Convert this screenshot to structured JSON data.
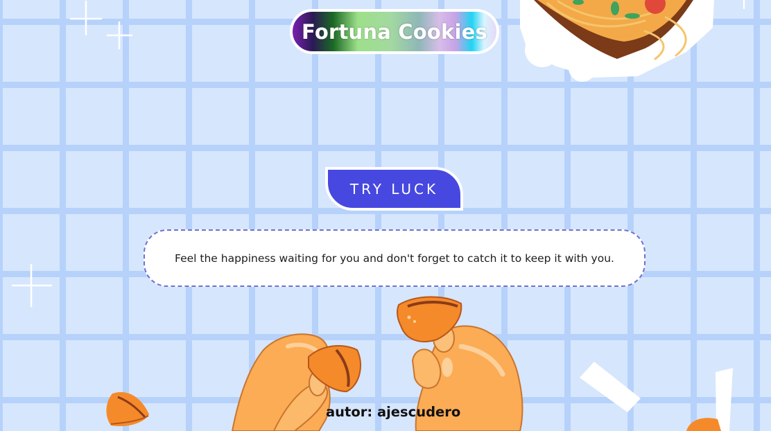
{
  "header": {
    "title": "Fortuna Cookies"
  },
  "main": {
    "try_button_label": "TRY LUCK",
    "fortune_message": "Feel the happiness waiting for you and don't forget to catch it to keep it with you."
  },
  "footer": {
    "author": "autor: ajescudero"
  },
  "decorations": [
    {
      "name": "noodle-box-illustration"
    },
    {
      "name": "sparkle-icon"
    },
    {
      "name": "hands-holding-cookies-illustration"
    },
    {
      "name": "fortune-cookie-icon"
    },
    {
      "name": "paper-strip-icon"
    }
  ],
  "colors": {
    "background": "#d6e6fd",
    "grid_lines": "#b6d2fb",
    "button": "#4748e0",
    "message_border": "#6d71cf",
    "cookie": "#f58a2a",
    "hand": "#fbac55"
  }
}
